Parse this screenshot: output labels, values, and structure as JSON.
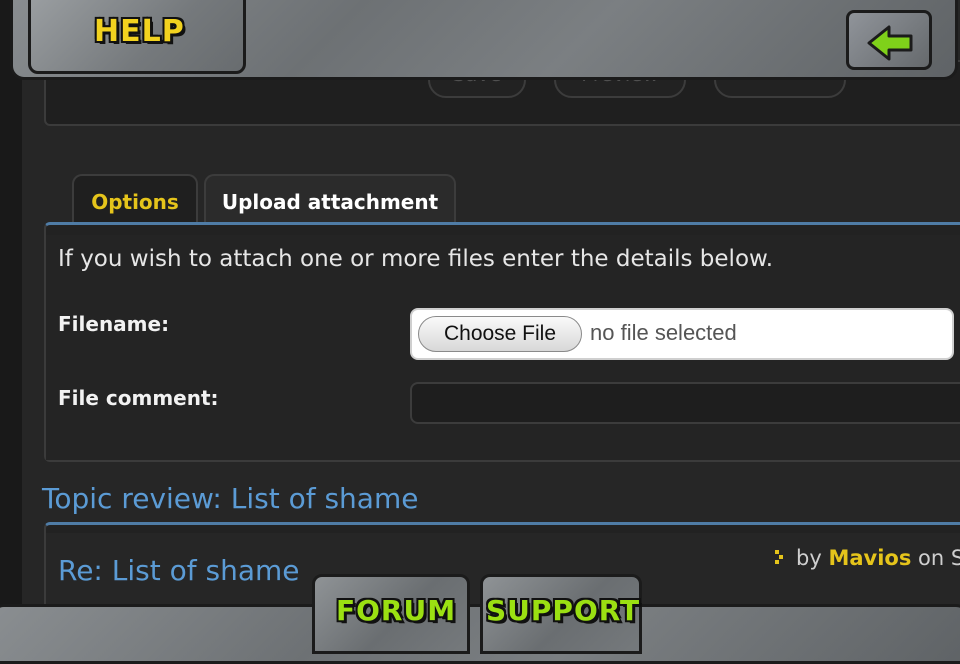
{
  "header": {
    "help_label": "HELP",
    "back_icon": "arrow-left-icon"
  },
  "post_form": {
    "buttons": [
      "Save",
      "Preview",
      ""
    ]
  },
  "tabs": [
    {
      "label": "Options",
      "active": false
    },
    {
      "label": "Upload attachment",
      "active": true
    }
  ],
  "upload": {
    "intro": "If you wish to attach one or more files enter the details below.",
    "filename_label": "Filename:",
    "choose_file_label": "Choose File",
    "no_file_text": "no file selected",
    "comment_label": "File comment:",
    "comment_value": ""
  },
  "topic_review": {
    "heading": "Topic review: List of shame",
    "post_title": "Re: List of shame",
    "by_prefix": "by",
    "author": "Mavios",
    "on_text": "on S"
  },
  "footer": {
    "forum_label": "FORUM",
    "support_label": "SUPPORT"
  },
  "colors": {
    "accent_blue": "#5b9bd5",
    "tab_yellow": "#e5c41b",
    "footer_green": "#9be012"
  }
}
